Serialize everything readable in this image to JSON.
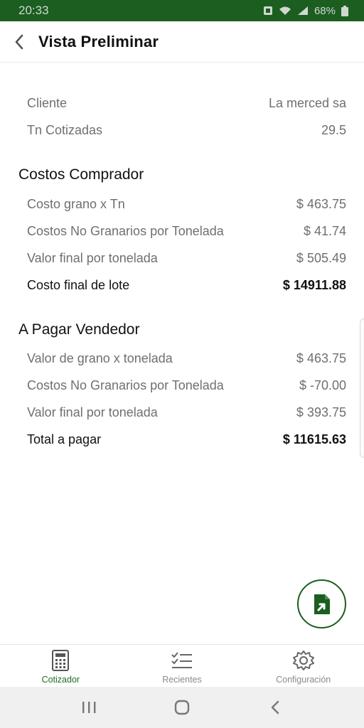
{
  "status_bar": {
    "time": "20:33",
    "battery": "68%"
  },
  "app_bar": {
    "title": "Vista Preliminar"
  },
  "summary": [
    {
      "label": "Cliente",
      "value": "La merced sa"
    },
    {
      "label": "Tn Cotizadas",
      "value": "29.5"
    }
  ],
  "comprador": {
    "title": "Costos Comprador",
    "rows": [
      {
        "label": "Costo grano x Tn",
        "value": "$ 463.75"
      },
      {
        "label": "Costos No Granarios por Tonelada",
        "value": "$ 41.74"
      },
      {
        "label": "Valor final por tonelada",
        "value": "$ 505.49"
      }
    ],
    "total": {
      "label": "Costo final de lote",
      "value": "$ 14911.88"
    }
  },
  "vendedor": {
    "title": "A Pagar Vendedor",
    "rows": [
      {
        "label": "Valor de grano x tonelada",
        "value": "$ 463.75"
      },
      {
        "label": "Costos No Granarios por Tonelada",
        "value": "$ -70.00"
      },
      {
        "label": "Valor final por tonelada",
        "value": "$ 393.75"
      }
    ],
    "total": {
      "label": "Total a pagar",
      "value": "$ 11615.63"
    }
  },
  "fab": {
    "icon": "export-file-icon"
  },
  "bottom_nav": [
    {
      "label": "Cotizador",
      "icon": "calculator-icon",
      "active": true
    },
    {
      "label": "Recientes",
      "icon": "checklist-icon",
      "active": false
    },
    {
      "label": "Configuración",
      "icon": "gear-icon",
      "active": false
    }
  ],
  "colors": {
    "primary": "#1b5e20",
    "active_label": "#1b6e24",
    "muted_text": "#6f6f6f"
  }
}
